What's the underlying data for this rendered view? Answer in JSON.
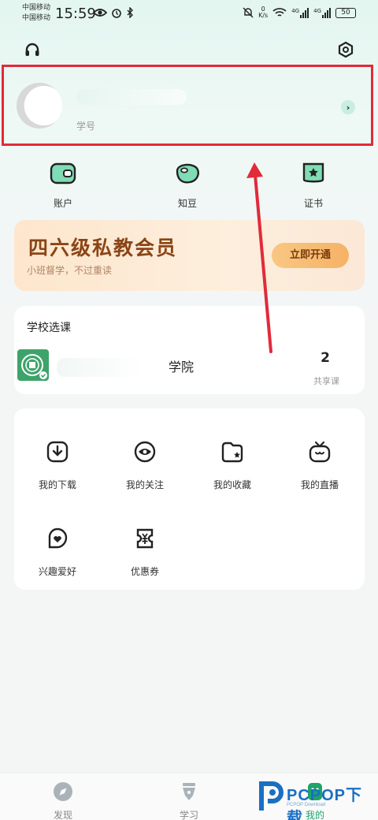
{
  "status_bar": {
    "carrier_1": "中国移动",
    "carrier_2": "中国移动",
    "time": "15:59",
    "net_speed_value": "0",
    "net_speed_unit": "K/s",
    "signal_1": "4G",
    "signal_2": "4G",
    "battery": "50"
  },
  "top_bar": {
    "left_icon": "headset-icon",
    "right_icon": "settings-hexagon-icon"
  },
  "profile": {
    "student_no_label": "学号",
    "arrow_icon": "chevron-right-icon"
  },
  "quick_actions": [
    {
      "label": "账户",
      "icon": "wallet-icon"
    },
    {
      "label": "知豆",
      "icon": "bean-icon"
    },
    {
      "label": "证书",
      "icon": "certificate-icon"
    }
  ],
  "banner": {
    "title": "四六级私教会员",
    "subtitle": "小班督学，不过重读",
    "button": "立即开通"
  },
  "school": {
    "section_title": "学校选课",
    "name_suffix": "学院",
    "shared_count": "2",
    "shared_label": "共享课"
  },
  "mine_menu": [
    {
      "label": "我的下载",
      "icon": "download-icon"
    },
    {
      "label": "我的关注",
      "icon": "eye-icon"
    },
    {
      "label": "我的收藏",
      "icon": "favorite-folder-icon"
    },
    {
      "label": "我的直播",
      "icon": "tv-icon"
    },
    {
      "label": "兴趣爱好",
      "icon": "heart-badge-icon"
    },
    {
      "label": "优惠券",
      "icon": "coupon-icon"
    }
  ],
  "tab_bar": [
    {
      "label": "发现",
      "icon": "compass-icon"
    },
    {
      "label": "学习",
      "icon": "pen-nib-icon"
    },
    {
      "label": "我的",
      "icon": "profile-icon"
    }
  ],
  "active_tab": "我的",
  "watermark": {
    "text": "PCPOP下载",
    "sub": "PCPOP Download"
  },
  "colors": {
    "accent": "#1ea36a",
    "highlight_border": "#e12a3a",
    "banner_title": "#8a4516"
  }
}
